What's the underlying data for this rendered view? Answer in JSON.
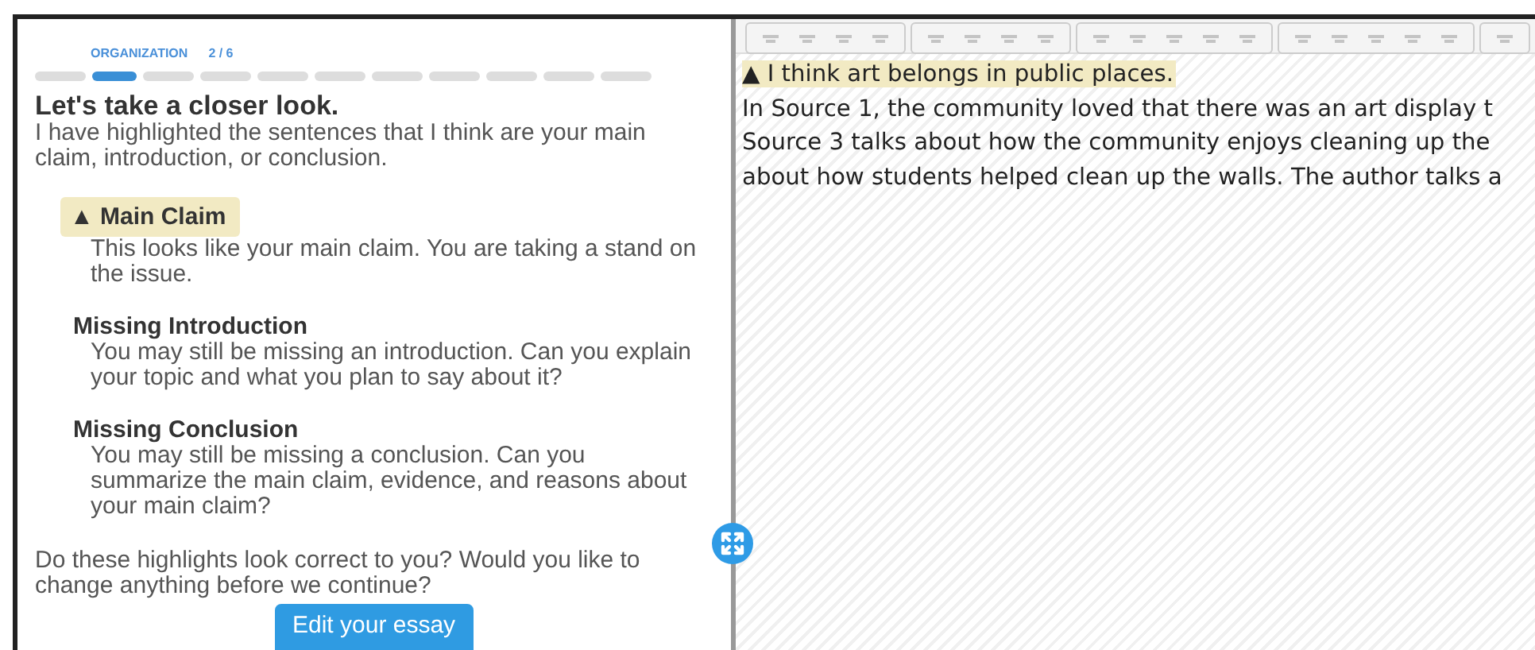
{
  "progress": {
    "section": "ORGANIZATION",
    "step": "2 / 6",
    "segments": [
      {
        "selected": false
      },
      {
        "selected": true
      },
      {
        "selected": false
      },
      {
        "selected": false
      },
      {
        "selected": false
      },
      {
        "selected": false
      },
      {
        "selected": false
      },
      {
        "selected": false
      },
      {
        "selected": false
      },
      {
        "selected": false
      },
      {
        "selected": false
      }
    ]
  },
  "heading": "Let's take a closer look.",
  "intro": "I have highlighted the sentences that I think are your main claim, introduction, or conclusion.",
  "feedback": [
    {
      "kind": "found",
      "marker": "▲",
      "title": "Main Claim",
      "text": "This looks like your main claim. You are taking a stand on the issue."
    },
    {
      "kind": "missing",
      "title": "Missing Introduction",
      "text": "You may still be missing an introduction. Can you explain your topic and what you plan to say about it?"
    },
    {
      "kind": "missing",
      "title": "Missing Conclusion",
      "text": "You may still be missing a conclusion. Can you summarize the main claim, evidence, and reasons about your main claim?"
    }
  ],
  "question": "Do these highlights look correct to you? Would you like to change anything before we continue?",
  "button": "Edit your essay",
  "essay": {
    "lines": [
      {
        "kind": "highlight",
        "marker": "▲",
        "text": "I think art belongs in public places."
      },
      {
        "kind": "plain",
        "text": "In Source 1, the community loved that there was an art display t"
      },
      {
        "kind": "plain",
        "text": "Source 3 talks about how the community enjoys cleaning up the"
      },
      {
        "kind": "plain",
        "text": "about how students helped clean up the walls. The author talks a"
      }
    ]
  }
}
